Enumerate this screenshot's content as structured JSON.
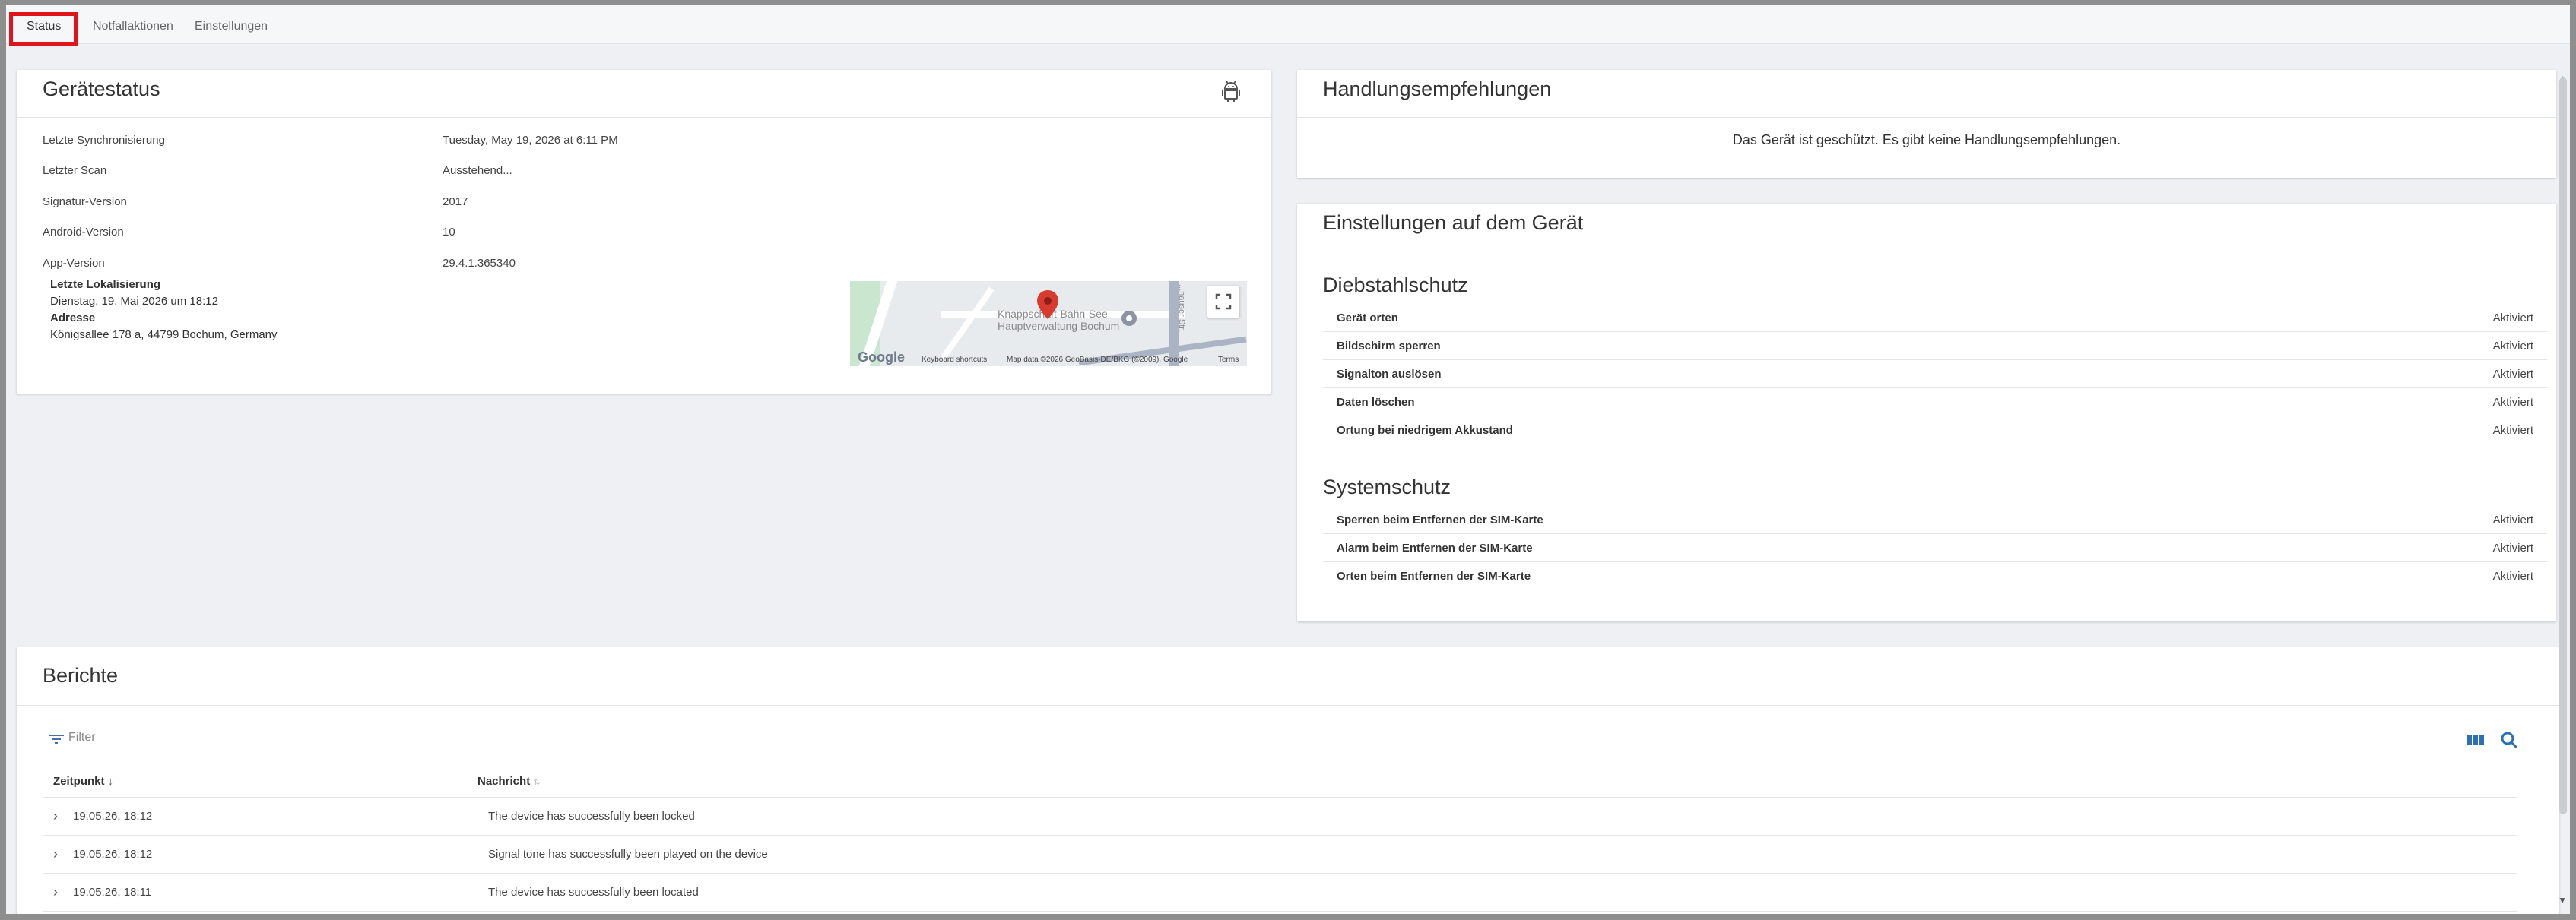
{
  "tabs": [
    {
      "label": "Status",
      "active": true
    },
    {
      "label": "Notfallaktionen",
      "active": false
    },
    {
      "label": "Einstellungen",
      "active": false
    }
  ],
  "device_status": {
    "title": "Gerätestatus",
    "icon": "android-icon",
    "rows": [
      {
        "label": "Letzte Synchronisierung",
        "value": "Tuesday, May 19, 2026 at 6:11 PM"
      },
      {
        "label": "Letzter Scan",
        "value": "Ausstehend..."
      },
      {
        "label": "Signatur-Version",
        "value": "2017"
      },
      {
        "label": "Android-Version",
        "value": "10"
      },
      {
        "label": "App-Version",
        "value": "29.4.1.365340"
      }
    ],
    "location": {
      "heading": "Letzte Lokalisierung",
      "date": "Dienstag, 19. Mai 2026 um 18:12",
      "address_heading": "Adresse",
      "address": "Königsallee 178 a, 44799 Bochum, Germany"
    },
    "map": {
      "place_label_1": "Knappschaft-Bahn-See",
      "place_label_2": "Hauptverwaltung Bochum",
      "street_label": "...hauser Str.",
      "google": "Google",
      "keyboard_shortcuts": "Keyboard shortcuts",
      "map_data": "Map data ©2026 GeoBasis-DE/BKG (©2009), Google",
      "terms": "Terms"
    }
  },
  "recommendations": {
    "title": "Handlungsempfehlungen",
    "text": "Das Gerät ist geschützt. Es gibt keine Handlungsempfehlungen."
  },
  "device_settings": {
    "title": "Einstellungen auf dem Gerät",
    "theft_protection": {
      "title": "Diebstahlschutz",
      "items": [
        {
          "label": "Gerät orten",
          "value": "Aktiviert"
        },
        {
          "label": "Bildschirm sperren",
          "value": "Aktiviert"
        },
        {
          "label": "Signalton auslösen",
          "value": "Aktiviert"
        },
        {
          "label": "Daten löschen",
          "value": "Aktiviert"
        },
        {
          "label": "Ortung bei niedrigem Akkustand",
          "value": "Aktiviert"
        }
      ]
    },
    "system_protection": {
      "title": "Systemschutz",
      "items": [
        {
          "label": "Sperren beim Entfernen der SIM-Karte",
          "value": "Aktiviert"
        },
        {
          "label": "Alarm beim Entfernen der SIM-Karte",
          "value": "Aktiviert"
        },
        {
          "label": "Orten beim Entfernen der SIM-Karte",
          "value": "Aktiviert"
        }
      ]
    }
  },
  "reports": {
    "title": "Berichte",
    "filter_label": "Filter",
    "columns": [
      "Zeitpunkt",
      "Nachricht"
    ],
    "rows": [
      {
        "time": "19.05.26, 18:12",
        "message": "The device has successfully been locked"
      },
      {
        "time": "19.05.26, 18:12",
        "message": "Signal tone has successfully been played on the device"
      },
      {
        "time": "19.05.26, 18:11",
        "message": "The device has successfully been located"
      }
    ]
  },
  "colors": {
    "active_tab_border": "#e0141b",
    "toolbar_icon": "#2f6fb5",
    "map_pin": "#d93a2f"
  }
}
